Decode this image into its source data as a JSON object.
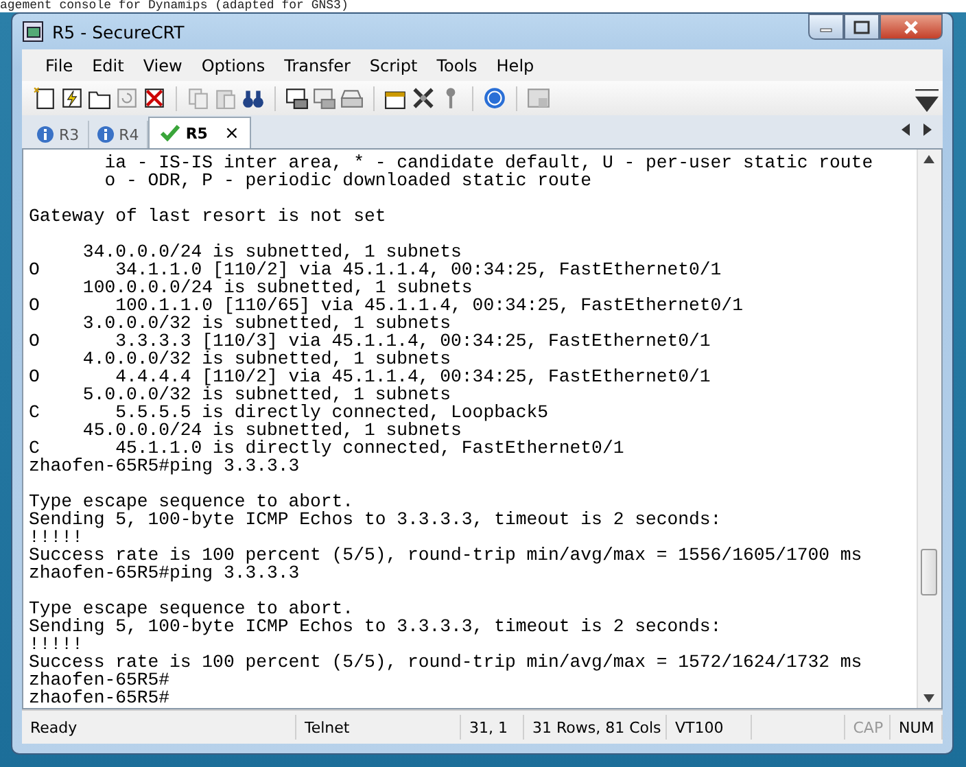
{
  "background_text": "agement console for Dynamips (adapted for GNS3)",
  "window": {
    "title": "R5 - SecureCRT"
  },
  "menu": [
    "File",
    "Edit",
    "View",
    "Options",
    "Transfer",
    "Script",
    "Tools",
    "Help"
  ],
  "tabs": [
    {
      "label": "R3",
      "selected": false,
      "kind": "info"
    },
    {
      "label": "R4",
      "selected": false,
      "kind": "info"
    },
    {
      "label": "R5",
      "selected": true,
      "kind": "connected",
      "close": "×"
    }
  ],
  "terminal": {
    "blocks": [
      [
        "       ia - IS-IS inter area, * - candidate default, U - per-user static route",
        "       o - ODR, P - periodic downloaded static route"
      ],
      [
        "Gateway of last resort is not set"
      ],
      [
        "     34.0.0.0/24 is subnetted, 1 subnets",
        "O       34.1.1.0 [110/2] via 45.1.1.4, 00:34:25, FastEthernet0/1",
        "     100.0.0.0/24 is subnetted, 1 subnets",
        "O       100.1.1.0 [110/65] via 45.1.1.4, 00:34:25, FastEthernet0/1",
        "     3.0.0.0/32 is subnetted, 1 subnets",
        "O       3.3.3.3 [110/3] via 45.1.1.4, 00:34:25, FastEthernet0/1",
        "     4.0.0.0/32 is subnetted, 1 subnets",
        "O       4.4.4.4 [110/2] via 45.1.1.4, 00:34:25, FastEthernet0/1",
        "     5.0.0.0/32 is subnetted, 1 subnets",
        "C       5.5.5.5 is directly connected, Loopback5",
        "     45.0.0.0/24 is subnetted, 1 subnets",
        "C       45.1.1.0 is directly connected, FastEthernet0/1",
        "zhaofen-65R5#ping 3.3.3.3"
      ],
      [
        "Type escape sequence to abort.",
        "Sending 5, 100-byte ICMP Echos to 3.3.3.3, timeout is 2 seconds:",
        "!!!!!",
        "Success rate is 100 percent (5/5), round-trip min/avg/max = 1556/1605/1700 ms",
        "zhaofen-65R5#ping 3.3.3.3"
      ],
      [
        "Type escape sequence to abort.",
        "Sending 5, 100-byte ICMP Echos to 3.3.3.3, timeout is 2 seconds:",
        "!!!!!",
        "Success rate is 100 percent (5/5), round-trip min/avg/max = 1572/1624/1732 ms",
        "zhaofen-65R5#",
        "zhaofen-65R5#"
      ]
    ]
  },
  "status_bar": [
    {
      "text": "Ready",
      "disabled": false
    },
    {
      "text": "Telnet",
      "disabled": false
    },
    {
      "text": "31,  1",
      "disabled": false
    },
    {
      "text": "31 Rows,  81 Cols",
      "disabled": false
    },
    {
      "text": "VT100",
      "disabled": false
    },
    {
      "text": "CAP",
      "disabled": true
    },
    {
      "text": "NUM",
      "disabled": false
    }
  ]
}
